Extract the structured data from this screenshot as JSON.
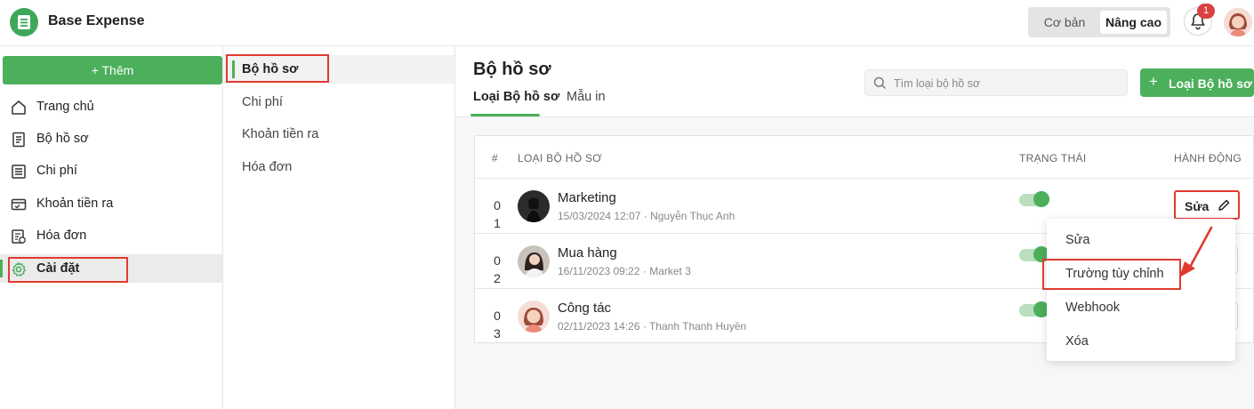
{
  "app": {
    "title": "Base Expense"
  },
  "header": {
    "mode_basic": "Cơ bản",
    "mode_advanced": "Nâng cao",
    "notification_count": "1"
  },
  "sidebar": {
    "add_label": "+ Thêm",
    "items": [
      {
        "label": "Trang chủ",
        "icon": "home-icon"
      },
      {
        "label": "Bộ hồ sơ",
        "icon": "document-icon"
      },
      {
        "label": "Chi phí",
        "icon": "expense-list-icon"
      },
      {
        "label": "Khoản tiền ra",
        "icon": "payment-card-icon"
      },
      {
        "label": "Hóa đơn",
        "icon": "invoice-icon"
      },
      {
        "label": "Cài đặt",
        "icon": "gear-icon",
        "active": true
      }
    ]
  },
  "settings_menu": {
    "items": [
      {
        "label": "Bộ hồ sơ",
        "active": true
      },
      {
        "label": "Chi phí"
      },
      {
        "label": "Khoản tiền ra"
      },
      {
        "label": "Hóa đơn"
      }
    ]
  },
  "main": {
    "title": "Bộ hồ sơ",
    "tabs": [
      {
        "label": "Loại Bộ hồ sơ",
        "active": true
      },
      {
        "label": "Mẫu in"
      }
    ],
    "search_placeholder": "Tìm loại bộ hồ sơ",
    "new_button_label": "Loại Bộ hồ sơ",
    "table": {
      "headers": [
        "#",
        "LOẠI BỘ HỒ SƠ",
        "TRẠNG THÁI",
        "HÀNH ĐỘNG"
      ],
      "rows": [
        {
          "index": "01",
          "name": "Marketing",
          "meta": "15/03/2024 12:07 · Nguyễn Thục Anh",
          "status_on": true
        },
        {
          "index": "02",
          "name": "Mua hàng",
          "meta": "16/11/2023 09:22 · Market 3",
          "status_on": true
        },
        {
          "index": "03",
          "name": "Công tác",
          "meta": "02/11/2023 14:26 · Thanh Thanh Huyền",
          "status_on": true
        }
      ],
      "edit_label": "Sửa"
    },
    "action_menu": [
      "Sửa",
      "Trường tùy chỉnh",
      "Webhook",
      "Xóa"
    ]
  },
  "colors": {
    "brand_green": "#4caf5c",
    "highlight_red": "#e03a2f",
    "notification_red": "#d94141"
  }
}
